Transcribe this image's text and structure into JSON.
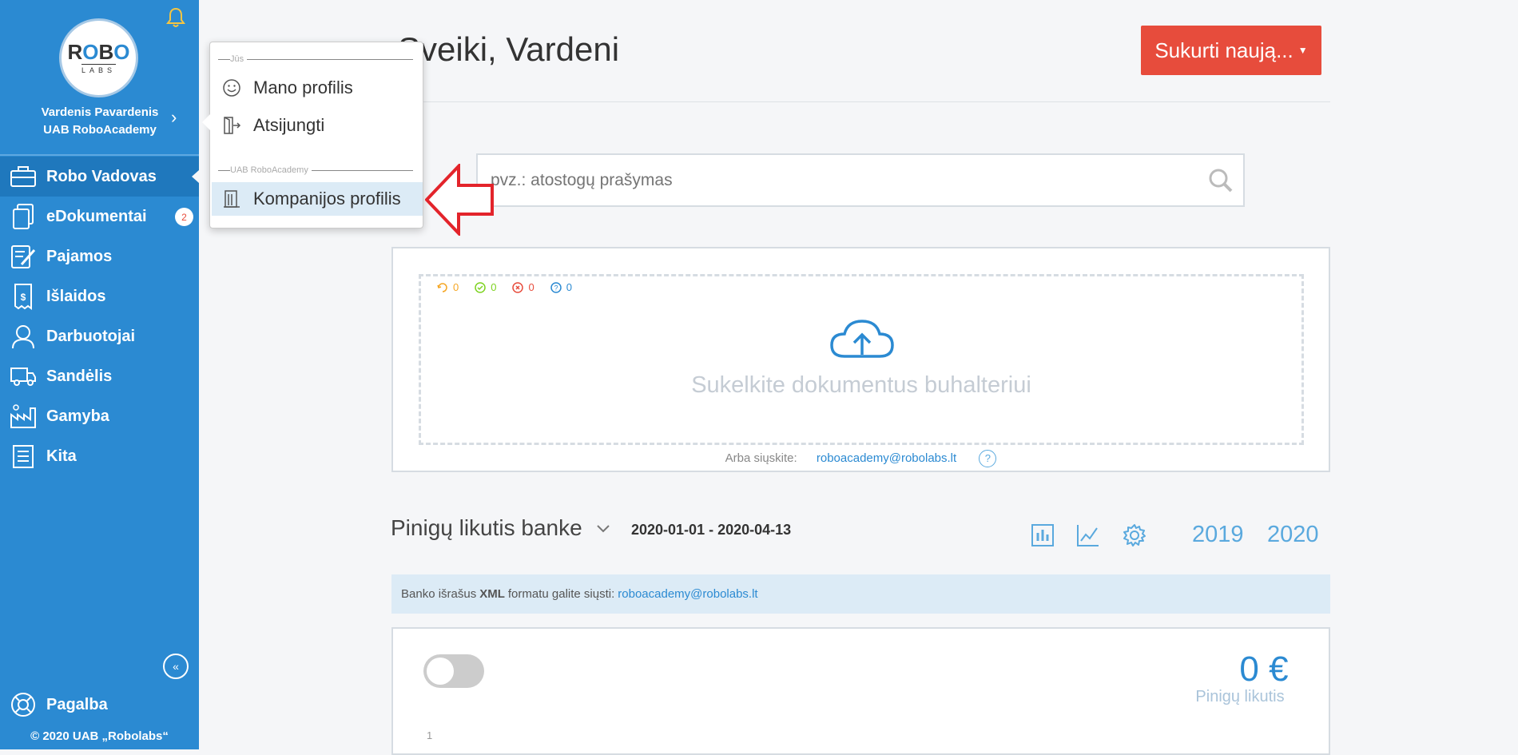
{
  "sidebar": {
    "logo": {
      "line1": "ROBO",
      "line2": "LABS"
    },
    "user": {
      "name": "Vardenis Pavardenis",
      "company": "UAB RoboAcademy"
    },
    "items": [
      {
        "label": "Robo Vadovas",
        "icon": "briefcase-icon",
        "active": true
      },
      {
        "label": "eDokumentai",
        "icon": "documents-icon",
        "badge": "2"
      },
      {
        "label": "Pajamos",
        "icon": "edit-document-icon"
      },
      {
        "label": "Išlaidos",
        "icon": "receipt-icon"
      },
      {
        "label": "Darbuotojai",
        "icon": "person-icon"
      },
      {
        "label": "Sandėlis",
        "icon": "truck-icon"
      },
      {
        "label": "Gamyba",
        "icon": "factory-icon"
      },
      {
        "label": "Kita",
        "icon": "list-icon"
      }
    ],
    "help_label": "Pagalba",
    "copyright": "© 2020 UAB „Robolabs“"
  },
  "popup": {
    "section_you": "Jūs",
    "my_profile": "Mano profilis",
    "logout": "Atsijungti",
    "section_company": "UAB RoboAcademy",
    "company_profile": "Kompanijos profilis"
  },
  "main": {
    "greeting": "Sveiki, Vardeni",
    "create_button": "Sukurti naują...",
    "search_placeholder": "pvz.: atostogų prašymas",
    "upload": {
      "counters": [
        {
          "icon": "refresh-icon",
          "value": "0",
          "color": "#f5a623"
        },
        {
          "icon": "check-circle-icon",
          "value": "0",
          "color": "#7ed321"
        },
        {
          "icon": "x-circle-icon",
          "value": "0",
          "color": "#e74c3c"
        },
        {
          "icon": "question-circle-icon",
          "value": "0",
          "color": "#2b8ad2"
        }
      ],
      "drop_text": "Sukelkite dokumentus buhalteriui",
      "send_label": "Arba siųskite:",
      "email": "roboacademy@robolabs.lt"
    },
    "bank": {
      "title": "Pinigų likutis banke",
      "date_range": "2020-01-01 - 2020-04-13",
      "years": [
        "2019",
        "2020"
      ],
      "info_prefix": "Banko išrašus",
      "info_bold": "XML",
      "info_suffix": "formatu galite siųsti:",
      "info_email": "roboacademy@robolabs.lt",
      "balance_value": "0 €",
      "balance_label": "Pinigų likutis",
      "axis_tick": "1"
    }
  },
  "colors": {
    "sidebar": "#2b8ad2",
    "accent": "#e74c3c",
    "link": "#2b8ad2"
  }
}
